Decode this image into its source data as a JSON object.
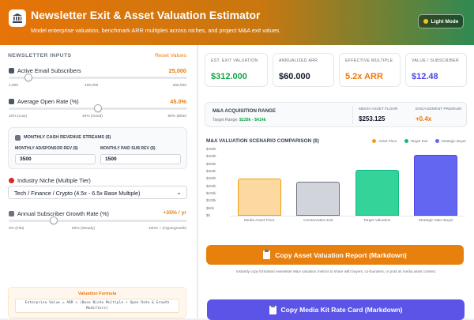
{
  "header": {
    "title": "Newsletter Exit & Asset Valuation Estimator",
    "subtitle": "Model enterprise valuation, benchmark ARR multiples across niches, and project M&A exit values.",
    "mode_label": "Light Mode"
  },
  "inputs": {
    "section_title": "NEWSLETTER INPUTS",
    "reset_label": "Reset Values",
    "subscribers": {
      "label": "Active Email Subscribers",
      "value": "25,000",
      "fraction": 0.11,
      "ticks": [
        "1,000",
        "100,000",
        "250,000"
      ]
    },
    "open_rate": {
      "label": "Average Open Rate (%)",
      "value": "45.0%",
      "fraction": 0.5,
      "ticks": [
        "10% (Low)",
        "40% (Good)",
        "80% (Elite)"
      ]
    },
    "revenue": {
      "title": "MONTHLY CASH REVENUE STREAMS ($)",
      "ad_label": "MONTHLY AD/SPONSOR REV ($)",
      "ad_value": "3500",
      "paid_label": "MONTHLY PAID SUB REV ($)",
      "paid_value": "1500"
    },
    "niche": {
      "label": "Industry Niche (Multiple Tier)",
      "selected": "Tech / Finance / Crypto (4.5x - 6.5x Base Multiple)"
    },
    "growth": {
      "label": "Annual Subscriber Growth Rate (%)",
      "value": "+35% / yr",
      "fraction": 0.25,
      "ticks": [
        "0% (Flat)",
        "50% (Steady)",
        "100% + (Hypergrowth)"
      ]
    },
    "formula": {
      "title": "Valuation Formula",
      "text": "Enterprise Value = ARR × (Base Niche Multiple + Open Rate & Growth Modifiers)"
    }
  },
  "cards": [
    {
      "label": "EST. EXIT VALUATION",
      "value": "$312.000",
      "color": "#16a34a"
    },
    {
      "label": "ANNUALIZED ARR",
      "value": "$60.000",
      "color": "#111827"
    },
    {
      "label": "EFFECTIVE MULTIPLE",
      "value": "5.2x ARR",
      "color": "#ea7a0c"
    },
    {
      "label": "VALUE / SUBSCRIBER",
      "value": "$12.48",
      "color": "#4f46e5"
    }
  ],
  "acquisition": {
    "title": "M&A ACQUISITION RANGE",
    "target_prefix": "Target Range:",
    "target_value": "$228k - $414k",
    "floor_label": "MEDIA ASSET FLOOR",
    "floor_value": "$253.125",
    "premium_label": "ENGAGEMENT PREMIUM",
    "premium_value": "+0.4x"
  },
  "chart_data": {
    "type": "bar",
    "title": "M&A VALUATION SCENARIO COMPARISON ($)",
    "categories": [
      "Media Asset Floor",
      "Conservative Exit",
      "Target Valuation",
      "Strategic M&A Buyer"
    ],
    "values": [
      253125,
      228000,
      312000,
      414000
    ],
    "colors": [
      "#fcd9a1",
      "#d1d5db",
      "#34d399",
      "#6366f1"
    ],
    "edge_colors": [
      "#f59e0b",
      "#6b7280",
      "#10b981",
      "#4f46e5"
    ],
    "ylim": [
      0,
      450000
    ],
    "yticks": [
      "$450k",
      "$400k",
      "$350k",
      "$300k",
      "$250k",
      "$200k",
      "$150k",
      "$100k",
      "$50k",
      "$0"
    ],
    "legend": [
      {
        "name": "Asset Floor",
        "color": "#f59e0b"
      },
      {
        "name": "Target Exit",
        "color": "#10b981"
      },
      {
        "name": "Strategic Buyer",
        "color": "#6366f1"
      }
    ]
  },
  "actions": {
    "copy_report": "Copy Asset Valuation Report (Markdown)",
    "copy_note": "Instantly copy formatted newsletter M&A valuation metrics to share with buyers, co-founders, or post as media asset content.",
    "copy_rate_card": "Copy Media Kit Rate Card (Markdown)"
  }
}
